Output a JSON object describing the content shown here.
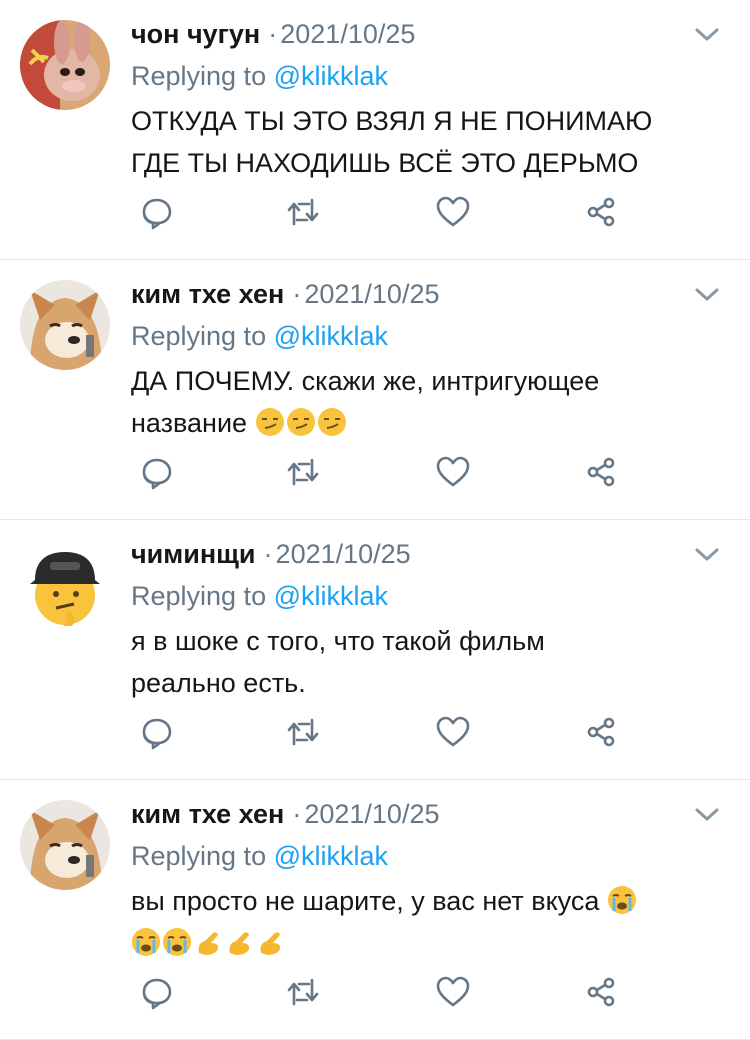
{
  "tweets": [
    {
      "name": "чон чугун",
      "date": "2021/10/25",
      "replying_prefix": "Replying to",
      "replying_handle": "@klikklak",
      "text_lines": [
        "ОТКУДА ТЫ ЭТО ВЗЯЛ Я НЕ ПОНИМАЮ",
        "ГДЕ ТЫ НАХОДИШЬ ВСЁ ЭТО ДЕРЬМО"
      ],
      "avatar": "rabbit-avatar"
    },
    {
      "name": "ким тхе хен",
      "date": "2021/10/25",
      "replying_prefix": "Replying to",
      "replying_handle": "@klikklak",
      "text_lines": [
        "ДА ПОЧЕМУ. скажи же, интригующее",
        "название"
      ],
      "emoji_line2": [
        "smirk-emoji",
        "smirk-emoji",
        "smirk-emoji"
      ],
      "avatar": "shiba-avatar"
    },
    {
      "name": "чиминщи",
      "date": "2021/10/25",
      "replying_prefix": "Replying to",
      "replying_handle": "@klikklak",
      "text_lines": [
        "я в шоке с того, что такой фильм",
        "реально есть."
      ],
      "avatar": "emoji-cap-avatar"
    },
    {
      "name": "ким тхе хен",
      "date": "2021/10/25",
      "replying_prefix": "Replying to",
      "replying_handle": "@klikklak",
      "text_lines": [
        "вы просто не шарите, у вас нет вкуса",
        ""
      ],
      "emoji_line1": [
        "crying-emoji"
      ],
      "emoji_line2": [
        "crying-emoji",
        "crying-emoji",
        "pinching-hand-emoji",
        "pinching-hand-emoji",
        "pinching-hand-emoji"
      ],
      "avatar": "shiba-avatar"
    }
  ],
  "actions": [
    "reply-icon",
    "retweet-icon",
    "like-icon",
    "share-icon"
  ],
  "colors": {
    "link": "#1da1f2",
    "muted": "#657786",
    "text": "#14171a",
    "divider": "#e1e8ed"
  }
}
